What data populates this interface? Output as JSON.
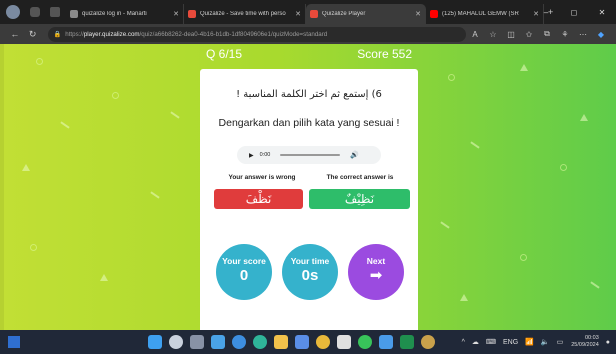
{
  "browser": {
    "tabs": [
      {
        "label": "quizalize log in - Manarti",
        "favicon_color": "#8b8b8b",
        "active": false
      },
      {
        "label": "Quizalize - Save time with perso",
        "favicon_color": "#e84a3b",
        "active": false
      },
      {
        "label": "Quizalize Player",
        "favicon_color": "#e84a3b",
        "active": true
      },
      {
        "label": "(125) MAHALUL GEMW (SR",
        "favicon_color": "#ff0000",
        "active": false
      }
    ],
    "url_prefix": "https://",
    "url_host": "player.quizalize.com",
    "url_rest": "/quiz/a66b8262-dea0-4b16-b1db-1df8049606e1/quizMode=standard",
    "window_controls": [
      "–",
      "◻",
      "✕"
    ]
  },
  "quiz": {
    "question_counter": "Q 6/15",
    "score_label": "Score 552",
    "instruction_arabic": "6) إستمع ثم اختر الكلمة المناسبة !",
    "instruction_indonesian": "Dengarkan dan pilih kata yang sesuai !",
    "audio_time": "0:00",
    "your_answer_label": "Your answer is wrong",
    "correct_answer_label": "The correct answer is",
    "your_answer": "نَظْفَ",
    "correct_answer": "نَظِيْفٌ",
    "your_score_label": "Your score",
    "your_score_value": "0",
    "your_time_label": "Your time",
    "your_time_value": "0s",
    "next_label": "Next"
  },
  "taskbar": {
    "language": "ENG",
    "time": "00:03",
    "date": "25/09/2024"
  },
  "colors": {
    "wrong": "#e03c3c",
    "correct": "#2ebd6a",
    "stat_circle": "#35b2cc",
    "next_circle": "#9b4be0"
  }
}
